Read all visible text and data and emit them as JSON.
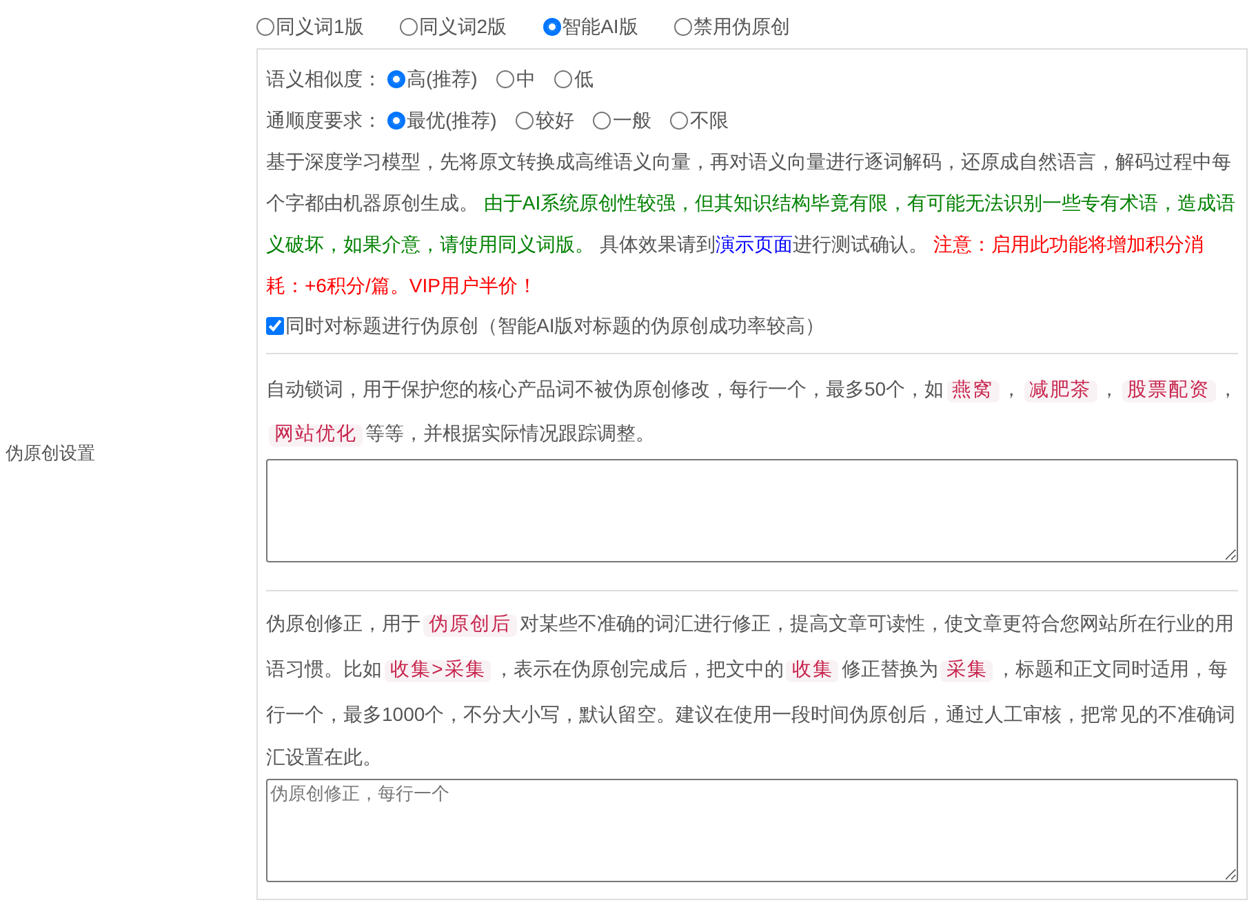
{
  "section_label": "伪原创设置",
  "modes": [
    {
      "label": "同义词1版",
      "selected": false
    },
    {
      "label": "同义词2版",
      "selected": false
    },
    {
      "label": "智能AI版",
      "selected": true
    },
    {
      "label": "禁用伪原创",
      "selected": false
    }
  ],
  "similarity": {
    "label": "语义相似度：",
    "options": [
      {
        "label": "高(推荐)",
        "selected": true
      },
      {
        "label": "中",
        "selected": false
      },
      {
        "label": "低",
        "selected": false
      }
    ]
  },
  "fluency": {
    "label": "通顺度要求：",
    "options": [
      {
        "label": "最优(推荐)",
        "selected": true
      },
      {
        "label": "较好",
        "selected": false
      },
      {
        "label": "一般",
        "selected": false
      },
      {
        "label": "不限",
        "selected": false
      }
    ]
  },
  "description": [
    {
      "kind": "plain",
      "text": "基于深度学习模型，先将原文转换成高维语义向量，再对语义向量进行逐词解码，还原成自然语言，解码过程中每个字都由机器原创生成。 "
    },
    {
      "kind": "success",
      "text": "由于AI系统原创性较强，但其知识结构毕竟有限，有可能无法识别一些专有术语，造成语义破坏，如果介意，请使用同义词版。"
    },
    {
      "kind": "plain",
      "text": " 具体效果请到"
    },
    {
      "kind": "link",
      "text": "演示页面"
    },
    {
      "kind": "plain",
      "text": "进行测试确认。 "
    },
    {
      "kind": "warning",
      "text": "注意：启用此功能将增加积分消耗：+6积分/篇。VIP用户半价！"
    }
  ],
  "title_option": {
    "label": "同时对标题进行伪原创（智能AI版对标题的伪原创成功率较高）",
    "checked": true
  },
  "lock_help": [
    {
      "kind": "plain",
      "text": "自动锁词，用于保护您的核心产品词不被伪原创修改，每行一个，最多50个，如"
    },
    {
      "kind": "code",
      "text": "燕窝"
    },
    {
      "kind": "plain",
      "text": "，"
    },
    {
      "kind": "code",
      "text": "减肥茶"
    },
    {
      "kind": "plain",
      "text": "，"
    },
    {
      "kind": "code",
      "text": "股票配资"
    },
    {
      "kind": "plain",
      "text": "，"
    },
    {
      "kind": "code",
      "text": "网站优化"
    },
    {
      "kind": "plain",
      "text": "等等，并根据实际情况跟踪调整。"
    }
  ],
  "correction_help": [
    {
      "kind": "plain",
      "text": "伪原创修正，用于"
    },
    {
      "kind": "code",
      "text": "伪原创后"
    },
    {
      "kind": "plain",
      "text": "对某些不准确的词汇进行修正，提高文章可读性，使文章更符合您网站所在行业的用语习惯。比如"
    },
    {
      "kind": "code",
      "text": "收集>采集"
    },
    {
      "kind": "plain",
      "text": "，表示在伪原创完成后，把文中的"
    },
    {
      "kind": "code",
      "text": "收集"
    },
    {
      "kind": "plain",
      "text": "修正替换为"
    },
    {
      "kind": "code",
      "text": "采集"
    },
    {
      "kind": "plain",
      "text": "，标题和正文同时适用，每行一个，最多1000个，不分大小写，默认留空。建议在使用一段时间伪原创后，通过人工审核，把常见的不准确词汇设置在此。"
    }
  ],
  "correction_field": {
    "placeholder": "伪原创修正，每行一个"
  }
}
